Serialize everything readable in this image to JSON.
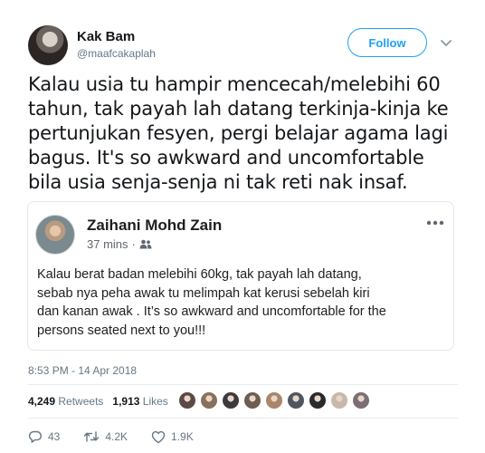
{
  "author": {
    "name": "Kak Bam",
    "handle": "@maafcakaplah"
  },
  "follow_button": {
    "label": "Follow"
  },
  "tweet": {
    "lines": [
      "Kalau usia tu hampir mencecah/melebihi 60",
      "tahun, tak payah lah datang terkinja-kinja ke",
      "pertunjukan fesyen, pergi belajar agama lagi",
      "bagus. It's so awkward and uncomfortable",
      "bila usia senja-senja ni tak reti nak insaf."
    ]
  },
  "quoted_post": {
    "name": "Zaihani Mohd Zain",
    "time": "37 mins",
    "separator": "·",
    "lines": [
      "Kalau berat badan melebihi 60kg, tak payah lah datang,",
      "sebab nya peha awak tu melimpah kat kerusi sebelah kiri",
      "dan kanan awak . It’s so awkward and uncomfortable for the",
      "persons seated next to you!!!"
    ]
  },
  "timestamp": "8:53 PM - 14 Apr 2018",
  "stats": {
    "retweets_count": "4,249",
    "retweets_label": "Retweets",
    "likes_count": "1,913",
    "likes_label": "Likes"
  },
  "likers": [
    "#5b4a44",
    "#8a6f5a",
    "#3c3a3d",
    "#6b5d52",
    "#a8856b",
    "#4f5660",
    "#2a2a2c",
    "#c7b8ac",
    "#7b6e75"
  ],
  "actions": {
    "reply_count": "43",
    "retweet_count": "4.2K",
    "like_count": "1.9K"
  },
  "colors": {
    "accent": "#1da1f2",
    "text": "#14171a",
    "muted": "#657786"
  }
}
